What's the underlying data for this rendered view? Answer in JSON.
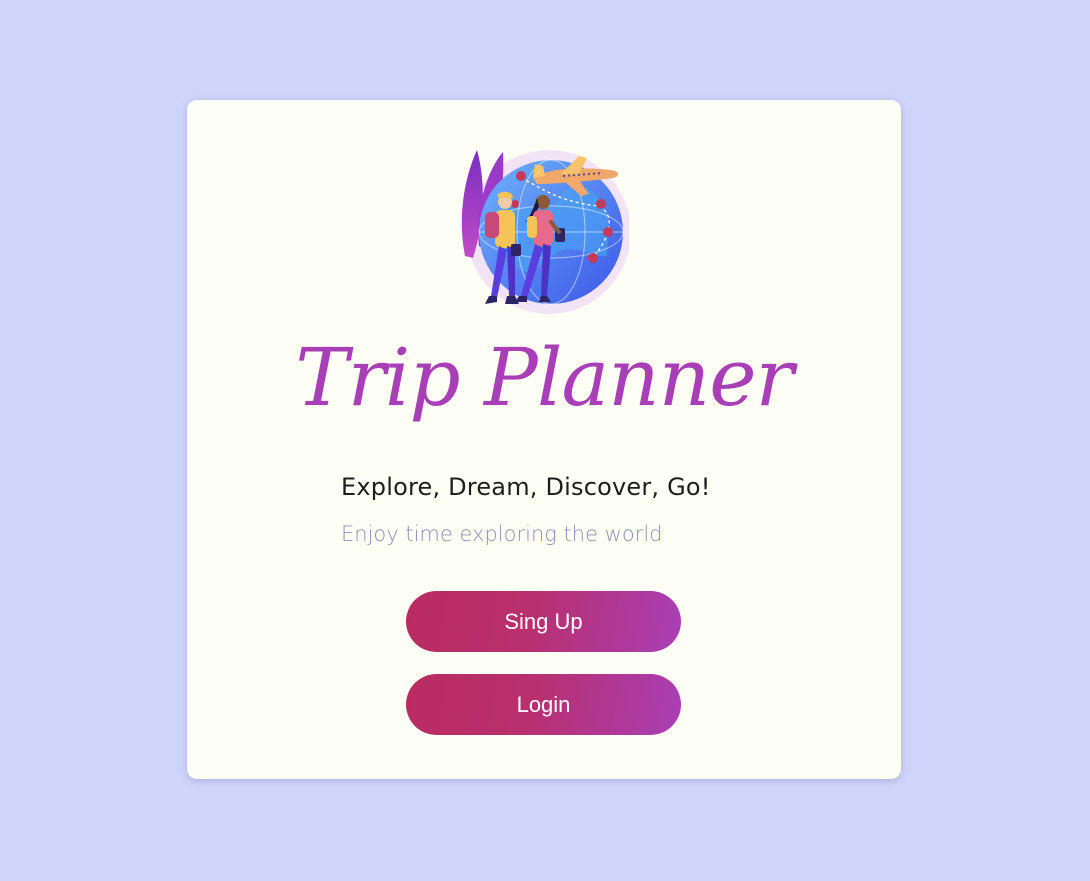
{
  "app": {
    "brand_title": "Trip Planner",
    "tagline": "Explore, Dream, Discover, Go!",
    "subtitle": "Enjoy time exploring the world"
  },
  "actions": {
    "signup_label": "Sing Up",
    "login_label": "Login"
  },
  "hero": {
    "icon": "travelers-globe-illustration"
  },
  "colors": {
    "page_background": "#cfd5fa",
    "card_background": "#fdfff5",
    "brand": "#a93fb6",
    "button_gradient_start": "#bb2b62",
    "button_gradient_end": "#a93fb6",
    "tagline": "#1e1e1e",
    "subtitle": "#8c90b4"
  }
}
